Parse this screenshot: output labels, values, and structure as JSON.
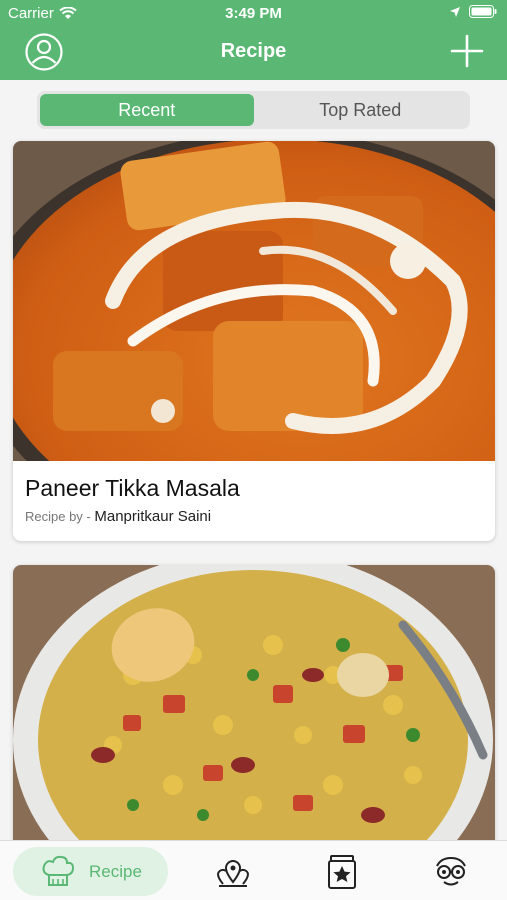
{
  "status": {
    "carrier": "Carrier",
    "time": "3:49 PM"
  },
  "header": {
    "title": "Recipe"
  },
  "segments": [
    {
      "label": "Recent"
    },
    {
      "label": "Top Rated"
    }
  ],
  "recipes": [
    {
      "title": "Paneer Tikka Masala",
      "recipe_by_label": "Recipe by -",
      "author": "Manpritkaur Saini"
    },
    {
      "title": "",
      "recipe_by_label": "",
      "author": ""
    }
  ],
  "tabbar": {
    "recipe_label": "Recipe"
  },
  "colors": {
    "accent": "#5ab874",
    "accent_light": "#dff2e4"
  }
}
